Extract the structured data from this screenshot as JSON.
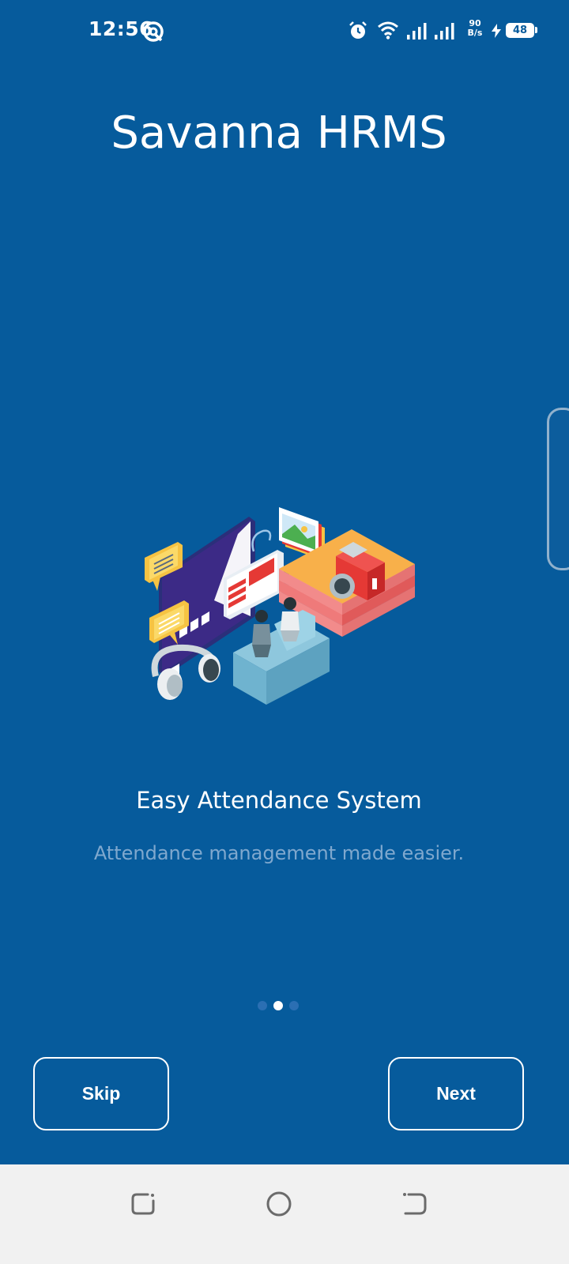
{
  "status_bar": {
    "time": "12:56",
    "net_speed_value": "90",
    "net_speed_unit": "B/s",
    "battery_level": "48",
    "icons": [
      "q-app-icon",
      "alarm-icon",
      "wifi-icon",
      "signal-icon",
      "signal-icon",
      "charging-icon",
      "battery-icon"
    ]
  },
  "app": {
    "title": "Savanna HRMS"
  },
  "slide": {
    "title": "Easy Attendance System",
    "subtitle": "Attendance management made easier.",
    "illustration": "isometric-office-illustration",
    "page_count": 3,
    "active_page": 2
  },
  "buttons": {
    "skip_label": "Skip",
    "next_label": "Next"
  },
  "nav_bar": {
    "icons": [
      "recent-apps-icon",
      "home-icon",
      "back-icon"
    ]
  },
  "colors": {
    "background": "#065B9C",
    "text": "#FFFFFF",
    "subtitle": "#7FA8CE",
    "dot_inactive": "#2B6FB3",
    "dot_active": "#FFFFFF",
    "nav_bar": "#F1F1F1"
  }
}
